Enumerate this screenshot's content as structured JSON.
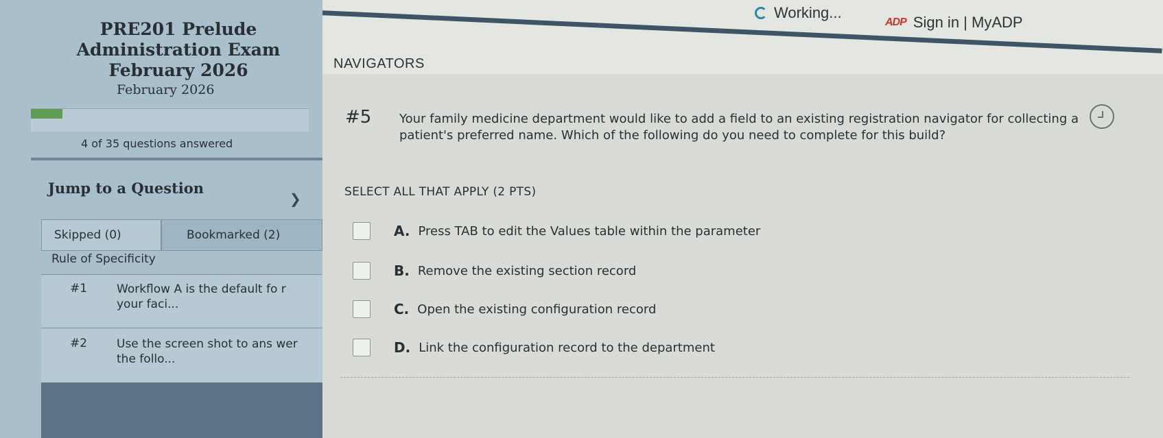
{
  "browser": {
    "working_label": "Working...",
    "adp_logo": "ADP",
    "signin_label": "Sign in | MyADP"
  },
  "sidebar": {
    "title_lines": [
      "PRE201 Prelude",
      "Administration Exam",
      "February 2026"
    ],
    "subtitle": "February 2026",
    "progress": {
      "answered": 4,
      "total": 35,
      "fraction": 0.114,
      "text": "4 of 35 questions answered",
      "color": "#5f9c54"
    },
    "jump_label": "Jump to a Question",
    "filters": {
      "skipped": "Skipped (0)",
      "bookmarked": "Bookmarked (2)"
    },
    "group_label": "Rule of Specificity",
    "questions": [
      {
        "num": "#1",
        "text": "Workflow A is the default fo r your faci..."
      },
      {
        "num": "#2",
        "text": "Use the screen shot to ans wer the follo..."
      }
    ]
  },
  "main": {
    "section_title": "NAVIGATORS",
    "question": {
      "number": "#5",
      "text": "Your family medicine department would like to add a field to an existing registration navigator for collecting a patient's preferred name. Which of the following do you need to complete for this build?",
      "instruction": "SELECT ALL THAT APPLY (2 PTS)",
      "options": [
        {
          "letter": "A.",
          "label": "Press TAB to edit the Values table within the parameter"
        },
        {
          "letter": "B.",
          "label": "Remove the existing section record"
        },
        {
          "letter": "C.",
          "label": "Open the existing configuration record"
        },
        {
          "letter": "D.",
          "label": "Link the configuration record to the department"
        }
      ]
    }
  },
  "icons": {
    "spinner": "loading-spinner-icon",
    "clock": "clock-icon",
    "chevron": "chevron-right-icon",
    "checkbox": "checkbox-icon"
  }
}
